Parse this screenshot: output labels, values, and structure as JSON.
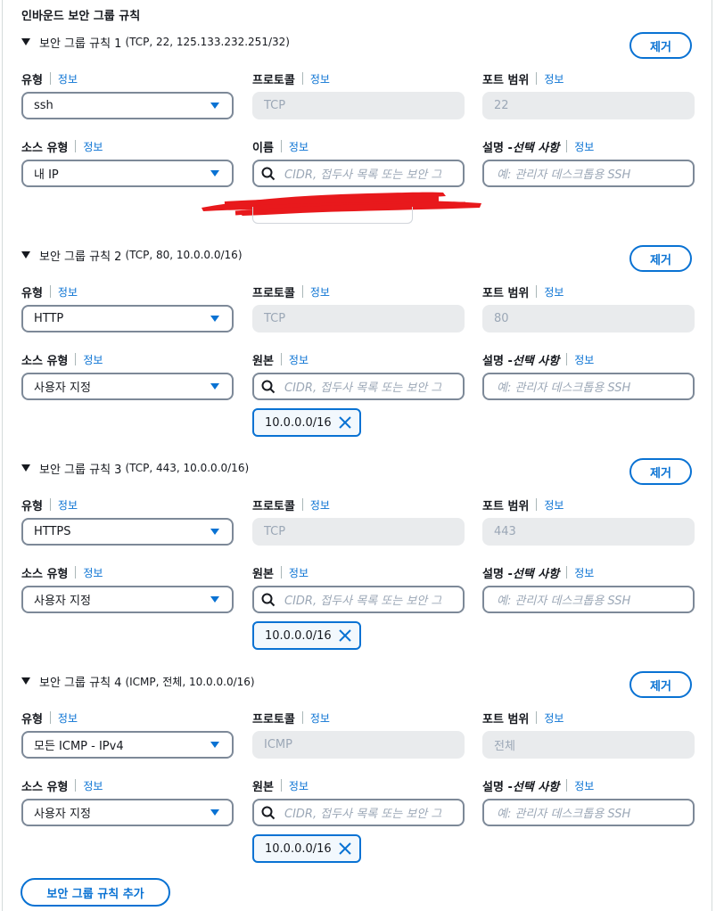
{
  "section_title": "인바운드 보안 그룹 규칙",
  "labels": {
    "type": "유형",
    "protocol": "프로토콜",
    "port_range": "포트 범위",
    "source_type": "소스 유형",
    "description_main": "설명 - ",
    "description_optional": "선택 사항",
    "info": "정보"
  },
  "search_placeholder": "CIDR, 접두사 목록 또는 보안 그",
  "description_placeholder": "예: 관리자 데스크톱용 SSH",
  "remove_label": "제거",
  "add_rule_label": "보안 그룹 규칙 추가",
  "rules": [
    {
      "title": "보안 그룹 규칙 1",
      "detail": "(TCP, 22, 125.133.232.251/32)",
      "type": "ssh",
      "protocol": "TCP",
      "port_range": "22",
      "source_type": "내 IP",
      "source_label": "이름",
      "token": ""
    },
    {
      "title": "보안 그룹 규칙 2",
      "detail": "(TCP, 80, 10.0.0.0/16)",
      "type": "HTTP",
      "protocol": "TCP",
      "port_range": "80",
      "source_type": "사용자 지정",
      "source_label": "원본",
      "token": "10.0.0.0/16"
    },
    {
      "title": "보안 그룹 규칙 3",
      "detail": "(TCP, 443, 10.0.0.0/16)",
      "type": "HTTPS",
      "protocol": "TCP",
      "port_range": "443",
      "source_type": "사용자 지정",
      "source_label": "원본",
      "token": "10.0.0.0/16"
    },
    {
      "title": "보안 그룹 규칙 4",
      "detail": "(ICMP, 전체, 10.0.0.0/16)",
      "type": "모든 ICMP - IPv4",
      "protocol": "ICMP",
      "port_range": "전체",
      "source_type": "사용자 지정",
      "source_label": "원본",
      "token": "10.0.0.0/16"
    }
  ],
  "colors": {
    "accent": "#0972d3",
    "redaction": "#e8191c",
    "disabled_bg": "#e9ebed"
  }
}
